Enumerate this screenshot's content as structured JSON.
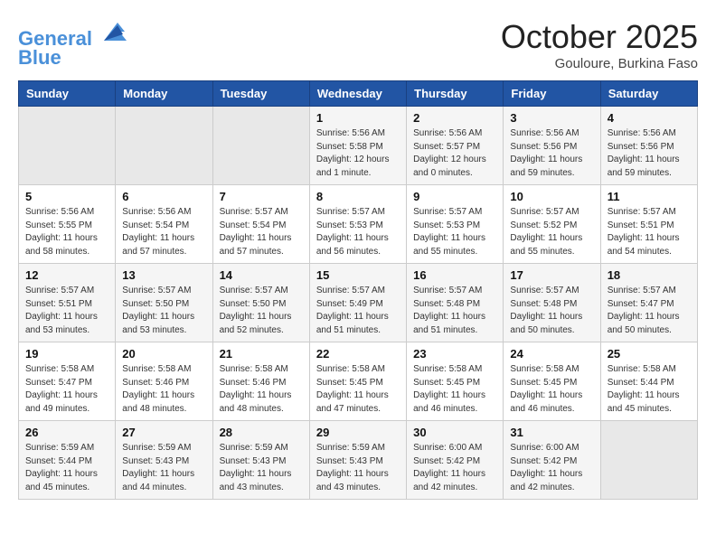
{
  "header": {
    "logo_line1": "General",
    "logo_line2": "Blue",
    "month": "October 2025",
    "location": "Gouloure, Burkina Faso"
  },
  "days_of_week": [
    "Sunday",
    "Monday",
    "Tuesday",
    "Wednesday",
    "Thursday",
    "Friday",
    "Saturday"
  ],
  "weeks": [
    [
      {
        "day": "",
        "data": ""
      },
      {
        "day": "",
        "data": ""
      },
      {
        "day": "",
        "data": ""
      },
      {
        "day": "1",
        "data": "Sunrise: 5:56 AM\nSunset: 5:58 PM\nDaylight: 12 hours and 1 minute."
      },
      {
        "day": "2",
        "data": "Sunrise: 5:56 AM\nSunset: 5:57 PM\nDaylight: 12 hours and 0 minutes."
      },
      {
        "day": "3",
        "data": "Sunrise: 5:56 AM\nSunset: 5:56 PM\nDaylight: 11 hours and 59 minutes."
      },
      {
        "day": "4",
        "data": "Sunrise: 5:56 AM\nSunset: 5:56 PM\nDaylight: 11 hours and 59 minutes."
      }
    ],
    [
      {
        "day": "5",
        "data": "Sunrise: 5:56 AM\nSunset: 5:55 PM\nDaylight: 11 hours and 58 minutes."
      },
      {
        "day": "6",
        "data": "Sunrise: 5:56 AM\nSunset: 5:54 PM\nDaylight: 11 hours and 57 minutes."
      },
      {
        "day": "7",
        "data": "Sunrise: 5:57 AM\nSunset: 5:54 PM\nDaylight: 11 hours and 57 minutes."
      },
      {
        "day": "8",
        "data": "Sunrise: 5:57 AM\nSunset: 5:53 PM\nDaylight: 11 hours and 56 minutes."
      },
      {
        "day": "9",
        "data": "Sunrise: 5:57 AM\nSunset: 5:53 PM\nDaylight: 11 hours and 55 minutes."
      },
      {
        "day": "10",
        "data": "Sunrise: 5:57 AM\nSunset: 5:52 PM\nDaylight: 11 hours and 55 minutes."
      },
      {
        "day": "11",
        "data": "Sunrise: 5:57 AM\nSunset: 5:51 PM\nDaylight: 11 hours and 54 minutes."
      }
    ],
    [
      {
        "day": "12",
        "data": "Sunrise: 5:57 AM\nSunset: 5:51 PM\nDaylight: 11 hours and 53 minutes."
      },
      {
        "day": "13",
        "data": "Sunrise: 5:57 AM\nSunset: 5:50 PM\nDaylight: 11 hours and 53 minutes."
      },
      {
        "day": "14",
        "data": "Sunrise: 5:57 AM\nSunset: 5:50 PM\nDaylight: 11 hours and 52 minutes."
      },
      {
        "day": "15",
        "data": "Sunrise: 5:57 AM\nSunset: 5:49 PM\nDaylight: 11 hours and 51 minutes."
      },
      {
        "day": "16",
        "data": "Sunrise: 5:57 AM\nSunset: 5:48 PM\nDaylight: 11 hours and 51 minutes."
      },
      {
        "day": "17",
        "data": "Sunrise: 5:57 AM\nSunset: 5:48 PM\nDaylight: 11 hours and 50 minutes."
      },
      {
        "day": "18",
        "data": "Sunrise: 5:57 AM\nSunset: 5:47 PM\nDaylight: 11 hours and 50 minutes."
      }
    ],
    [
      {
        "day": "19",
        "data": "Sunrise: 5:58 AM\nSunset: 5:47 PM\nDaylight: 11 hours and 49 minutes."
      },
      {
        "day": "20",
        "data": "Sunrise: 5:58 AM\nSunset: 5:46 PM\nDaylight: 11 hours and 48 minutes."
      },
      {
        "day": "21",
        "data": "Sunrise: 5:58 AM\nSunset: 5:46 PM\nDaylight: 11 hours and 48 minutes."
      },
      {
        "day": "22",
        "data": "Sunrise: 5:58 AM\nSunset: 5:45 PM\nDaylight: 11 hours and 47 minutes."
      },
      {
        "day": "23",
        "data": "Sunrise: 5:58 AM\nSunset: 5:45 PM\nDaylight: 11 hours and 46 minutes."
      },
      {
        "day": "24",
        "data": "Sunrise: 5:58 AM\nSunset: 5:45 PM\nDaylight: 11 hours and 46 minutes."
      },
      {
        "day": "25",
        "data": "Sunrise: 5:58 AM\nSunset: 5:44 PM\nDaylight: 11 hours and 45 minutes."
      }
    ],
    [
      {
        "day": "26",
        "data": "Sunrise: 5:59 AM\nSunset: 5:44 PM\nDaylight: 11 hours and 45 minutes."
      },
      {
        "day": "27",
        "data": "Sunrise: 5:59 AM\nSunset: 5:43 PM\nDaylight: 11 hours and 44 minutes."
      },
      {
        "day": "28",
        "data": "Sunrise: 5:59 AM\nSunset: 5:43 PM\nDaylight: 11 hours and 43 minutes."
      },
      {
        "day": "29",
        "data": "Sunrise: 5:59 AM\nSunset: 5:43 PM\nDaylight: 11 hours and 43 minutes."
      },
      {
        "day": "30",
        "data": "Sunrise: 6:00 AM\nSunset: 5:42 PM\nDaylight: 11 hours and 42 minutes."
      },
      {
        "day": "31",
        "data": "Sunrise: 6:00 AM\nSunset: 5:42 PM\nDaylight: 11 hours and 42 minutes."
      },
      {
        "day": "",
        "data": ""
      }
    ]
  ]
}
